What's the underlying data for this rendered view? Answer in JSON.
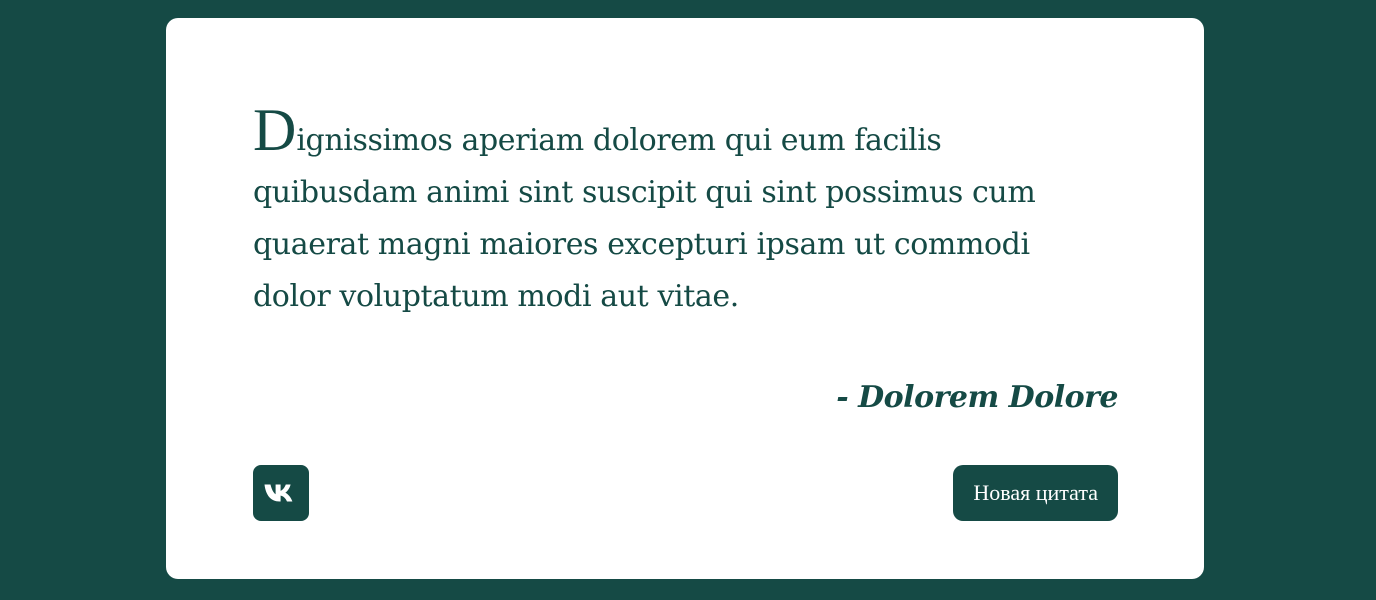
{
  "quote": {
    "first_letter": "D",
    "rest": "ignissimos aperiam dolorem qui eum facilis quibusdam animi sint suscipit qui sint possimus cum quaerat magni maiores excepturi ipsam ut commodi dolor voluptatum modi aut vitae.",
    "author": "- Dolorem Dolore"
  },
  "actions": {
    "share_icon": "vk-icon",
    "new_quote_label": "Новая цитата"
  },
  "colors": {
    "background": "#154a45",
    "card": "#ffffff",
    "accent": "#154a45"
  }
}
